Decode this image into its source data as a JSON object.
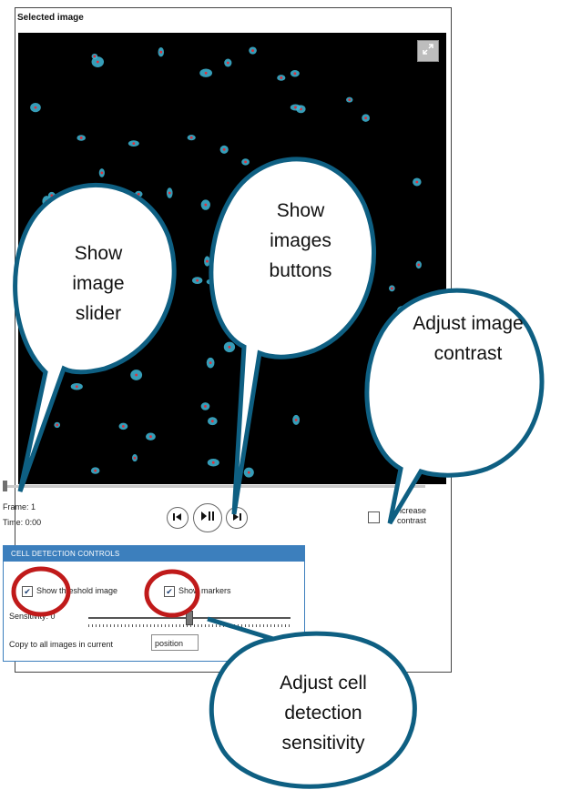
{
  "panel": {
    "title": "Selected image"
  },
  "viewer": {
    "frame_text": "Frame: 1",
    "time_text": "Time:   0:00",
    "image_slider_value": 0
  },
  "contrast": {
    "label": "Increase contrast",
    "checked": false
  },
  "cell_detection": {
    "header": "CELL DETECTION CONTROLS",
    "show_threshold_label": "Show threshold image",
    "show_markers_label": "Show markers",
    "show_threshold_checked": true,
    "show_markers_checked": true,
    "sensitivity_label": "Sensitivity: 0",
    "sensitivity_value": 0.5,
    "copy_label": "Copy to all images in current",
    "copy_select_value": "position"
  },
  "callouts": {
    "slider": "Show image slider",
    "buttons": "Show images buttons",
    "contrast": "Adjust image contrast",
    "sensitivity": "Adjust cell detection sensitivity"
  },
  "colors": {
    "callout_stroke": "#0e5f82",
    "highlight_ring": "#c01a1a",
    "header_blue": "#3c7fbd",
    "cell_cyan": "#3fb8d8",
    "cell_marker": "#e0303a"
  },
  "icons": {
    "expand": "expand-icon",
    "previous": "step-back-icon",
    "play_pause": "play-pause-icon",
    "next": "step-forward-icon"
  }
}
